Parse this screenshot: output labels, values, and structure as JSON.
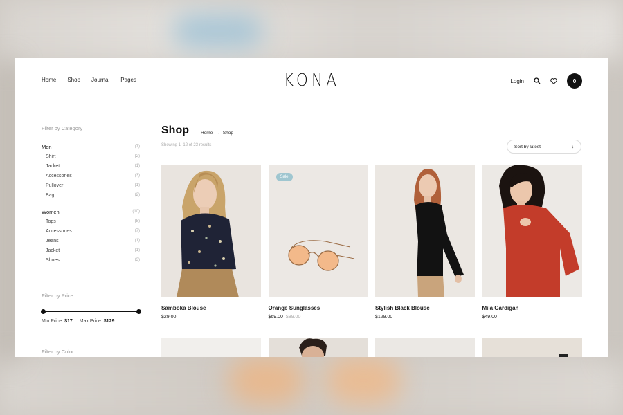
{
  "nav": {
    "items": [
      "Home",
      "Shop",
      "Journal",
      "Pages"
    ],
    "active": "Shop"
  },
  "brand": {
    "logo": "KONA"
  },
  "header": {
    "login": "Login",
    "cart_count": "0"
  },
  "sidebar": {
    "category_title": "Filter by Category",
    "groups": [
      {
        "label": "Men",
        "count": "(7)",
        "items": [
          {
            "label": "Shirt",
            "count": "(2)"
          },
          {
            "label": "Jacket",
            "count": "(1)"
          },
          {
            "label": "Accessories",
            "count": "(3)"
          },
          {
            "label": "Pullover",
            "count": "(1)"
          },
          {
            "label": "Bag",
            "count": "(2)"
          }
        ]
      },
      {
        "label": "Women",
        "count": "(10)",
        "items": [
          {
            "label": "Tops",
            "count": "(8)"
          },
          {
            "label": "Accessories",
            "count": "(7)"
          },
          {
            "label": "Jeans",
            "count": "(1)"
          },
          {
            "label": "Jacket",
            "count": "(1)"
          },
          {
            "label": "Shoes",
            "count": "(3)"
          }
        ]
      }
    ],
    "price_title": "Filter by Price",
    "min_label": "Min Price:",
    "min_value": "$17",
    "max_label": "Max Price:",
    "max_value": "$129",
    "color_title": "Filter by Color"
  },
  "main": {
    "title": "Shop",
    "breadcrumb": [
      "Home",
      "Shop"
    ],
    "breadcrumb_sep": "→",
    "showing": "Showing 1–12 of 23 results",
    "sort": "Sort by latest",
    "products": [
      {
        "name": "Samboka Blouse",
        "price": "$29.00",
        "old_price": "",
        "badge": ""
      },
      {
        "name": "Orange Sunglasses",
        "price": "$69.00",
        "old_price": "$89.00",
        "badge": "Sale"
      },
      {
        "name": "Stylish Black Blouse",
        "price": "$129.00",
        "old_price": "",
        "badge": ""
      },
      {
        "name": "Mila Gardigan",
        "price": "$49.00",
        "old_price": "",
        "badge": ""
      }
    ]
  },
  "colors": {
    "sale_badge": "#9fc6d0",
    "text_dark": "#111111",
    "muted": "#aaaaaa"
  }
}
